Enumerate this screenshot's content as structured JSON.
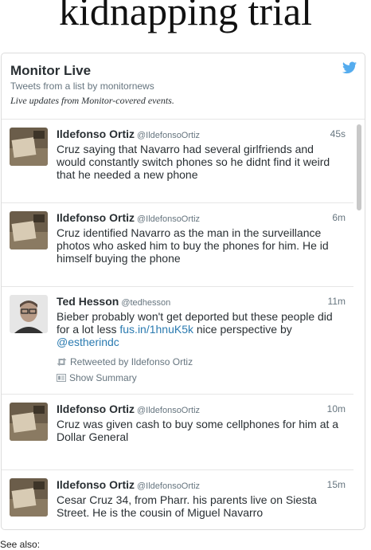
{
  "page": {
    "headline": "kidnapping trial",
    "see_also": "See also:"
  },
  "widget": {
    "title": "Monitor Live",
    "subtitle": "Tweets from a list by monitornews",
    "description": "Live updates from Monitor-covered events.",
    "brand_color": "#55acee"
  },
  "tweets": [
    {
      "name": "Ildefonso Ortiz",
      "handle": "@IldefonsoOrtiz",
      "time": "45s",
      "text": "Cruz saying that Navarro had several girlfriends and would constantly switch phones so he didnt find it weird that he needed a new phone"
    },
    {
      "name": "Ildefonso Ortiz",
      "handle": "@IldefonsoOrtiz",
      "time": "6m",
      "text": "Cruz identified Navarro as the man in the surveillance photos who asked him to buy the phones for him. He id himself buying the phone"
    },
    {
      "name": "Ted Hesson",
      "handle": "@tedhesson",
      "time": "11m",
      "text_before": "Bieber probably won't get deported but these people did for a lot less ",
      "link": "fus.in/1hnuK5k",
      "text_middle": " nice perspective by ",
      "mention": "@estherindc",
      "retweet": "Retweeted by Ildefonso Ortiz",
      "summary": "Show Summary"
    },
    {
      "name": "Ildefonso Ortiz",
      "handle": "@IldefonsoOrtiz",
      "time": "10m",
      "text": "Cruz was given cash to buy some cellphones for him at a Dollar General"
    },
    {
      "name": "Ildefonso Ortiz",
      "handle": "@IldefonsoOrtiz",
      "time": "15m",
      "text": "Cesar Cruz 34, from Pharr. his parents live on Siesta Street. He is the cousin of Miguel Navarro"
    }
  ]
}
